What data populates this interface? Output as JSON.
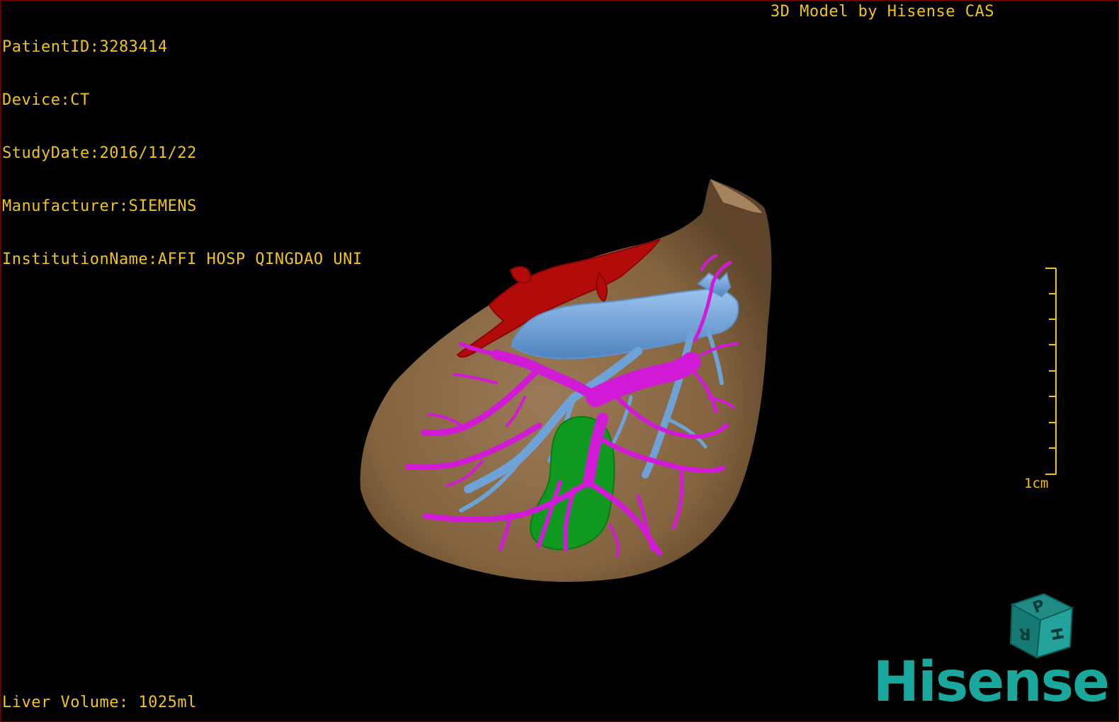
{
  "dicom_info": {
    "patient_id": "PatientID:3283414",
    "device": "Device:CT",
    "study_date": "StudyDate:2016/11/22",
    "manufacturer": "Manufacturer:SIEMENS",
    "institution": "InstitutionName:AFFI HOSP QINGDAO UNI"
  },
  "credit": "3D Model by Hisense CAS",
  "liver_volume": "Liver Volume: 1025ml",
  "scale": {
    "label": "1cm"
  },
  "orientation_cube": {
    "letters": [
      "P",
      "H",
      "R"
    ]
  },
  "brand": {
    "name": "Hisense",
    "color": "#1aa79c"
  },
  "colors": {
    "text": "#f0c419",
    "liver": "#8b6a47",
    "artery": "#b30a0a",
    "hepatic_vein": "#6fa3d8",
    "portal_vein": "#d11ad6",
    "lesion": "#0f9a1f"
  }
}
